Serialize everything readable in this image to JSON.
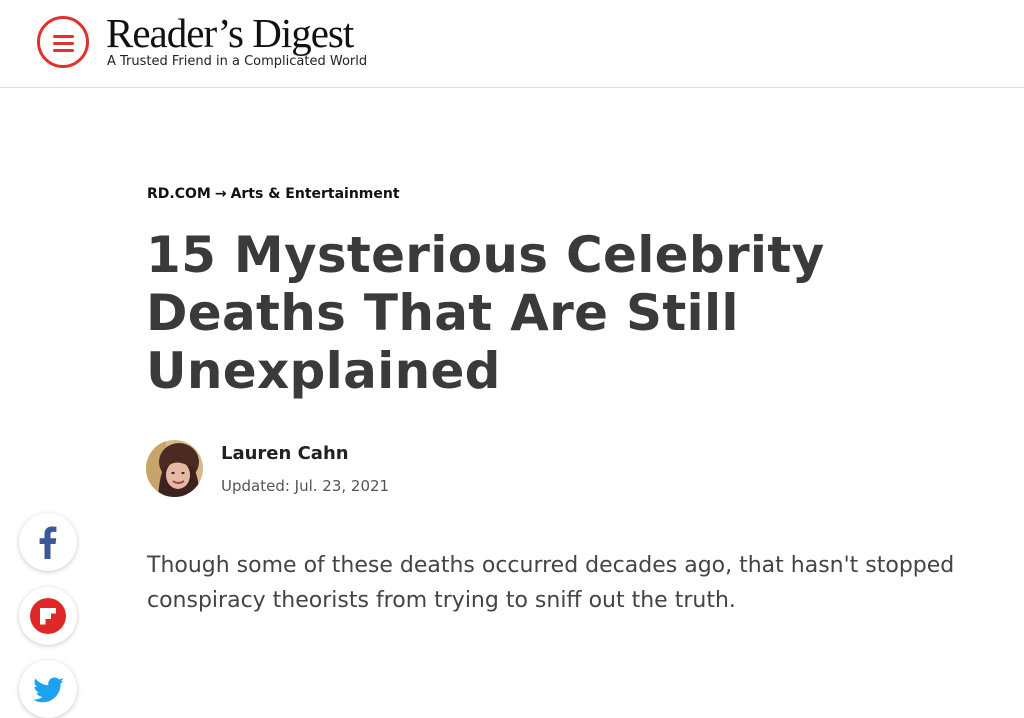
{
  "header": {
    "logo_text": "Reader’s Digest",
    "tagline": "A Trusted Friend in a Complicated World"
  },
  "breadcrumb": {
    "home": "RD.COM",
    "separator": "→",
    "section": "Arts & Entertainment"
  },
  "article": {
    "title": "15 Mysterious Celebrity Deaths That Are Still Unexplained",
    "author": "Lauren Cahn",
    "updated": "Updated: Jul. 23, 2021",
    "dek": "Though some of these deaths occurred decades ago, that hasn't stopped conspiracy theorists from trying to sniff out the truth."
  },
  "icons": {
    "menu": "hamburger-menu-icon",
    "facebook": "facebook-icon",
    "flipboard": "flipboard-icon",
    "twitter": "twitter-icon"
  },
  "colors": {
    "brand_red": "#e0312d",
    "facebook": "#3b5998",
    "flipboard": "#e12828",
    "twitter": "#1da1f2",
    "title": "#3a3a3a"
  }
}
